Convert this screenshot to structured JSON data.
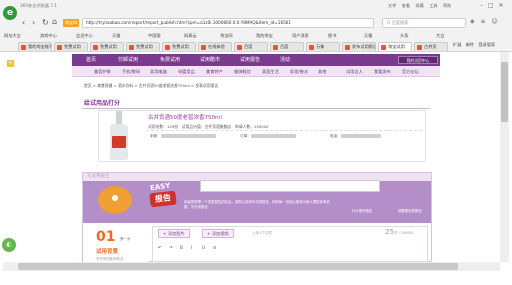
{
  "browser": {
    "window_title": "360安全浏览器 7.1",
    "site_badge": "淘宝网",
    "url": "http://try.taobao.com/report/report_publish.htm?spm=a1z0i.1000800.0.0.Y8MAQ&item_id=16561",
    "search_placeholder": "Q 百度搜索",
    "window_buttons": {
      "file": "文件",
      "view": "查看",
      "fav": "收藏",
      "tools": "工具",
      "help": "帮助"
    },
    "bookmarks": [
      "网址大全",
      "游戏中心",
      "会员中心",
      "天猫",
      "中国银",
      "网易云",
      "淘宝网",
      "我的淘宝",
      "用户消息",
      "图书",
      "天猫",
      "头条",
      "大会"
    ],
    "tabs": [
      "我的淘宝账号",
      "免费试用",
      "免费试用",
      "免费试用",
      "免费试用",
      "在线体验",
      "百度",
      "百度",
      "万象",
      "发布试用报告",
      "淘宝试用",
      "古井贡"
    ],
    "tab_extra": {
      "expand": "扩展",
      "mail": "邮件",
      "login": "登录管家"
    }
  },
  "site": {
    "nav_primary": [
      "首页",
      "付邮试用",
      "免费试用",
      "试用酷市",
      "试用报告",
      "活动"
    ],
    "nav_user": "我的试用中心",
    "nav_secondary": [
      "美容护肤",
      "手机/数码",
      "家用电器",
      "母婴用品",
      "美食特产",
      "服饰鞋包",
      "家居生活",
      "彩妆/香水",
      "其他",
      "试用达人",
      "我要发布",
      "官方论坛"
    ],
    "breadcrumb": "首页 > 美食保健 > 酒水饮料 > 古井贡酒50度老窖浓香750ml > 发表试用报告",
    "section_title": "给试用品打分",
    "product": {
      "name": "古井贡酒50度老窖浓香750ml",
      "meta": "试用份数：129份　试用品价值：古井贡酒旗舰店　申请人数：250000",
      "row_labels": [
        "到家：",
        "订单：",
        "电话："
      ],
      "row_values": [
        "",
        "",
        ""
      ]
    },
    "report": {
      "header": "写试用报告",
      "banner_easy": "EASY",
      "banner_baogao": "报告",
      "banner_text": "恭喜您获得一个发表报告的机会，请您认真填写试用报告，你的每一份用心都将为他人提供参考依据，写试用报告",
      "banner_link1": "什么是好报告",
      "banner_link2": "我要看优秀报告",
      "step_num": "01",
      "step_label": "第一步",
      "step_title": "试用背景",
      "step_desc": "写写您的基本情况",
      "btn_add_image": "+ 添加图片",
      "btn_add_video": "+ 添加视频",
      "counter_label": "字 / 200000",
      "counter_value": "25",
      "upload_hint": "上传1个文件",
      "toolbar": [
        "↶",
        "↷",
        "B",
        "I",
        "U",
        "≡"
      ]
    }
  }
}
